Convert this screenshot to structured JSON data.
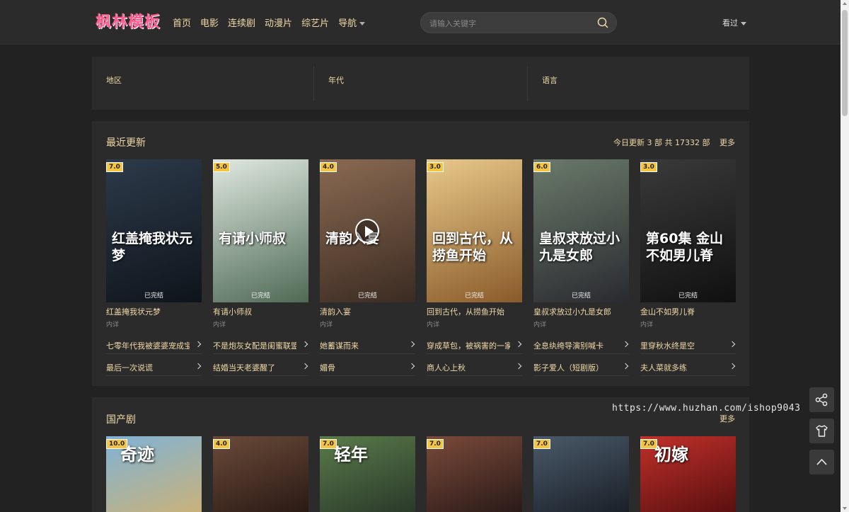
{
  "header": {
    "logo": "枫林模板",
    "nav": [
      "首页",
      "电影",
      "连续剧",
      "动漫片",
      "综艺片",
      "导航"
    ],
    "search_placeholder": "请输入关键字",
    "history_label": "看过"
  },
  "filter": {
    "labels": [
      "地区",
      "年代",
      "语言"
    ]
  },
  "recent": {
    "title": "最近更新",
    "meta_today_prefix": "今日更新",
    "meta_today_count": "3",
    "meta_unit_1": "部",
    "meta_total_prefix": "共",
    "meta_total_count": "17332",
    "meta_unit_2": "部",
    "more": "更多",
    "cards": [
      {
        "score": "7.0",
        "poster_text": "红盖掩我状元梦",
        "status": "已完结",
        "name": "红盖掩我状元梦",
        "sub": "内详",
        "color_a": "#2c3a4a",
        "color_b": "#0f141b"
      },
      {
        "score": "5.0",
        "poster_text": "有请小师叔",
        "status": "已完结",
        "name": "有请小师叔",
        "sub": "内详",
        "color_a": "#dfe8e0",
        "color_b": "#4f6a55"
      },
      {
        "score": "4.0",
        "poster_text": "清韵入宴",
        "status": "已完结",
        "name": "清韵入宴",
        "sub": "内详",
        "color_a": "#8a6a52",
        "color_b": "#3b2b22"
      },
      {
        "score": "3.0",
        "poster_text": "回到古代，从捞鱼开始",
        "status": "已完结",
        "name": "回到古代，从捞鱼开始",
        "sub": "内详",
        "color_a": "#e8c98a",
        "color_b": "#8a5a2a"
      },
      {
        "score": "6.0",
        "poster_text": "皇叔求放过小九是女郎",
        "status": "已完结",
        "name": "皇叔求放过小九是女郎",
        "sub": "内详",
        "color_a": "#6a7a6a",
        "color_b": "#2a2a30"
      },
      {
        "score": "3.0",
        "poster_text": "第60集 金山不如男儿脊",
        "status": "已完结",
        "name": "金山不如男儿脊",
        "sub": "内详",
        "color_a": "#3a3a3a",
        "color_b": "#101010"
      }
    ],
    "list_rows": [
      [
        "七零年代我被婆婆宠成宝",
        "不是炮灰女配是闺蜜联盟",
        "她蓄谋而来",
        "穿成草包，被祸害的一家...",
        "全息纨绔导演别喊卡",
        "里穿秋水终是空"
      ],
      [
        "最后一次说谎",
        "结婚当天老婆醒了",
        "媚骨",
        "商人心上秋",
        "影子爱人（短剧版）",
        "夫人菜就多练"
      ]
    ]
  },
  "domestic": {
    "title": "国产剧",
    "more": "更多",
    "cards": [
      {
        "score": "10.0",
        "poster_text": "奇迹",
        "color_a": "#7fb2d6",
        "color_b": "#c9b27a"
      },
      {
        "score": "4.0",
        "poster_text": "",
        "color_a": "#6a4a3a",
        "color_b": "#2a1a14"
      },
      {
        "score": "7.0",
        "poster_text": "轻年",
        "color_a": "#5a7a4a",
        "color_b": "#2a3a2a"
      },
      {
        "score": "7.0",
        "poster_text": "",
        "color_a": "#7a4a3a",
        "color_b": "#2a1a18"
      },
      {
        "score": "7.0",
        "poster_text": "",
        "color_a": "#4a5a6a",
        "color_b": "#1a2028"
      },
      {
        "score": "7.0",
        "poster_text": "初嫁",
        "color_a": "#c0302a",
        "color_b": "#5a1010"
      }
    ]
  },
  "watermark": "https://www.huzhan.com/ishop9043",
  "colors": {
    "accent": "#f0d9a6",
    "logo": "#ff5a8f",
    "score_badge": "#f5c542",
    "background": "#222222",
    "panel": "#2b2b2b"
  },
  "icons": [
    "search-icon",
    "chevron-down-icon",
    "play-icon",
    "chevron-right-icon",
    "share-icon",
    "shirt-icon",
    "arrow-up-icon"
  ]
}
